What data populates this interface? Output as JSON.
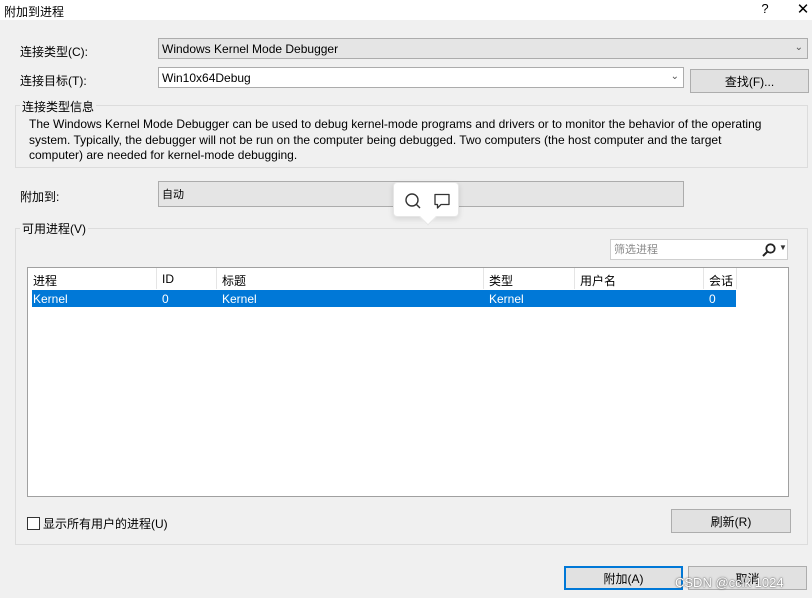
{
  "window": {
    "title": "附加到进程",
    "help_label": "?",
    "close_label": "✕"
  },
  "connection": {
    "type_label": "连接类型(C):",
    "type_value": "Windows Kernel Mode Debugger",
    "target_label": "连接目标(T):",
    "target_value": "Win10x64Debug",
    "find_button": "查找(F)..."
  },
  "info": {
    "group_title": "连接类型信息",
    "text": "The Windows Kernel Mode Debugger can be used to debug kernel-mode programs and drivers or to monitor the behavior of the operating system. Typically, the debugger will not be run on the computer being debugged. Two computers (the host computer and the target computer) are needed for kernel-mode debugging."
  },
  "attach_to": {
    "label": "附加到:",
    "value": "自动"
  },
  "processes": {
    "group_title": "可用进程(V)",
    "filter_placeholder": "筛选进程",
    "columns": [
      "进程",
      "ID",
      "标题",
      "类型",
      "用户名",
      "会话"
    ],
    "rows": [
      [
        "Kernel",
        "0",
        "Kernel",
        "Kernel",
        "",
        "0"
      ]
    ],
    "show_all_users_label": "显示所有用户的进程(U)",
    "refresh_button": "刷新(R)"
  },
  "footer": {
    "attach_button": "附加(A)",
    "cancel_button": "取消"
  },
  "popup": {
    "icons": [
      "search-icon",
      "comment-icon"
    ]
  },
  "watermark": "CSDN @cclk 1024",
  "colors": {
    "selection": "#0078d7",
    "dialog_bg": "#f0f0f0",
    "readonly_bg": "#e5e5e5"
  }
}
